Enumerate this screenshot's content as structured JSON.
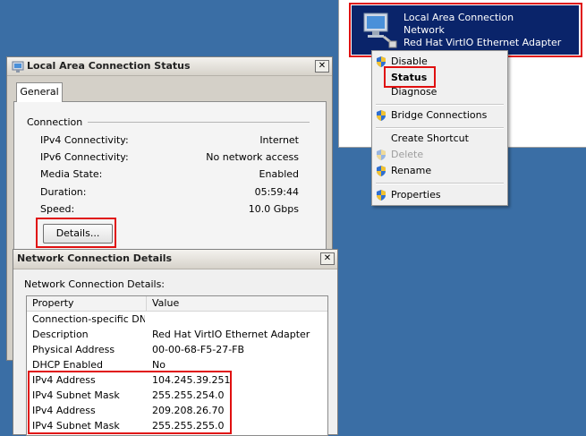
{
  "adapter": {
    "name": "Local Area Connection",
    "network": "Network",
    "device": "Red Hat VirtIO Ethernet Adapter",
    "icon": "network-adapter-icon"
  },
  "context_menu": {
    "items": [
      {
        "label": "Disable"
      },
      {
        "label": "Status"
      },
      {
        "label": "Diagnose"
      },
      {
        "label": "Bridge Connections"
      },
      {
        "label": "Create Shortcut"
      },
      {
        "label": "Delete"
      },
      {
        "label": "Rename"
      },
      {
        "label": "Properties"
      }
    ]
  },
  "status_dialog": {
    "title": "Local Area Connection Status",
    "tab": "General",
    "group": "Connection",
    "rows": [
      {
        "label": "IPv4 Connectivity:",
        "value": "Internet"
      },
      {
        "label": "IPv6 Connectivity:",
        "value": "No network access"
      },
      {
        "label": "Media State:",
        "value": "Enabled"
      },
      {
        "label": "Duration:",
        "value": "05:59:44"
      },
      {
        "label": "Speed:",
        "value": "10.0 Gbps"
      }
    ],
    "details_button": "Details..."
  },
  "details_dialog": {
    "title": "Network Connection Details",
    "caption": "Network Connection Details:",
    "headers": [
      "Property",
      "Value"
    ],
    "rows": [
      {
        "property": "Connection-specific DN...",
        "value": ""
      },
      {
        "property": "Description",
        "value": "Red Hat VirtIO Ethernet Adapter"
      },
      {
        "property": "Physical Address",
        "value": "00-00-68-F5-27-FB"
      },
      {
        "property": "DHCP Enabled",
        "value": "No"
      },
      {
        "property": "IPv4 Address",
        "value": "104.245.39.251"
      },
      {
        "property": "IPv4 Subnet Mask",
        "value": "255.255.254.0"
      },
      {
        "property": "IPv4 Address",
        "value": "209.208.26.70"
      },
      {
        "property": "IPv4 Subnet Mask",
        "value": "255.255.255.0"
      }
    ]
  },
  "colors": {
    "desktop": "#3a6ea5",
    "selection": "#0a246a",
    "highlight_box": "#e01010"
  }
}
